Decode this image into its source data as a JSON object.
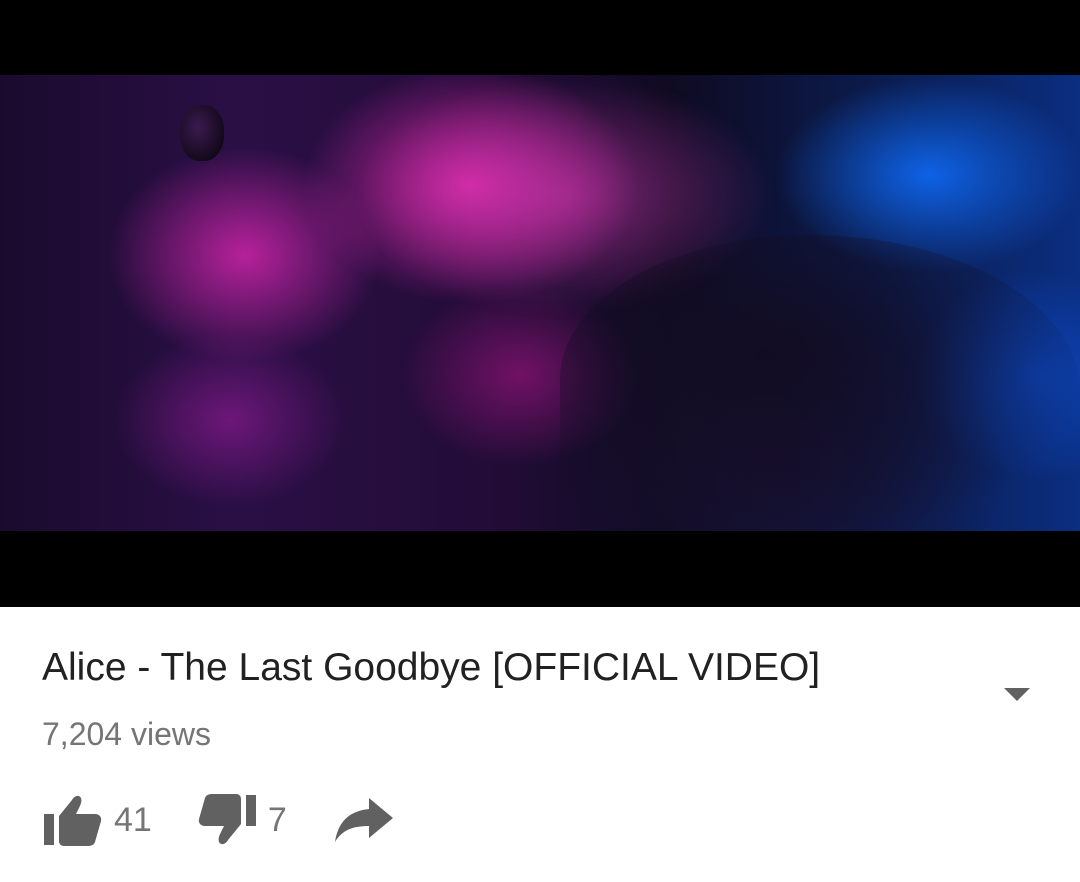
{
  "video": {
    "title": "Alice - The Last Goodbye [OFFICIAL VIDEO]",
    "views": "7,204 views"
  },
  "actions": {
    "likes": "41",
    "dislikes": "7"
  },
  "icons": {
    "like": "thumbs-up-icon",
    "dislike": "thumbs-down-icon",
    "share": "share-arrow-icon",
    "expand": "chevron-down-icon"
  },
  "colors": {
    "text_primary": "#212121",
    "text_secondary": "#757575",
    "icon": "#616161",
    "player_background": "#000000"
  }
}
